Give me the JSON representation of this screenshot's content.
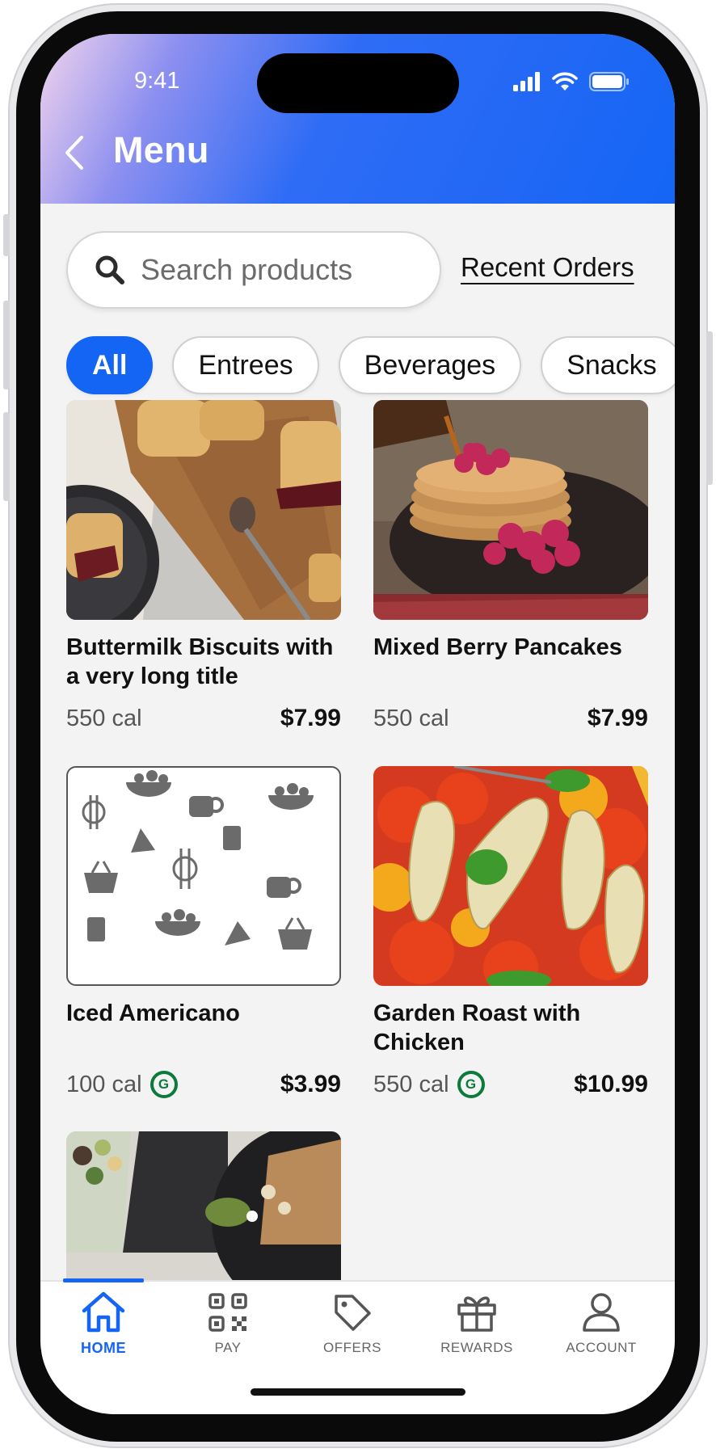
{
  "status": {
    "time": "9:41"
  },
  "header": {
    "title": "Menu"
  },
  "search": {
    "placeholder": "Search products"
  },
  "recent_orders_label": "Recent Orders",
  "filters": [
    {
      "label": "All",
      "active": true
    },
    {
      "label": "Entrees",
      "active": false
    },
    {
      "label": "Beverages",
      "active": false
    },
    {
      "label": "Snacks",
      "active": false
    }
  ],
  "products": [
    {
      "title": "Buttermilk Biscuits with a very long title",
      "calories": "550 cal",
      "price": "$7.99",
      "badge": ""
    },
    {
      "title": "Mixed Berry Pancakes",
      "calories": "550 cal",
      "price": "$7.99",
      "badge": ""
    },
    {
      "title": "Iced Americano",
      "calories": "100 cal",
      "price": "$3.99",
      "badge": "G"
    },
    {
      "title": "Garden Roast with Chicken",
      "calories": "550 cal",
      "price": "$10.99",
      "badge": "G"
    }
  ],
  "tabbar": {
    "items": [
      {
        "label": "HOME",
        "icon": "home-icon",
        "active": true
      },
      {
        "label": "PAY",
        "icon": "qr-code-icon",
        "active": false
      },
      {
        "label": "OFFERS",
        "icon": "tag-icon",
        "active": false
      },
      {
        "label": "REWARDS",
        "icon": "gift-icon",
        "active": false
      },
      {
        "label": "ACCOUNT",
        "icon": "person-icon",
        "active": false
      }
    ]
  },
  "colors": {
    "accent": "#1565f5",
    "green_badge": "#0b7a3b",
    "background": "#f3f3f3"
  }
}
